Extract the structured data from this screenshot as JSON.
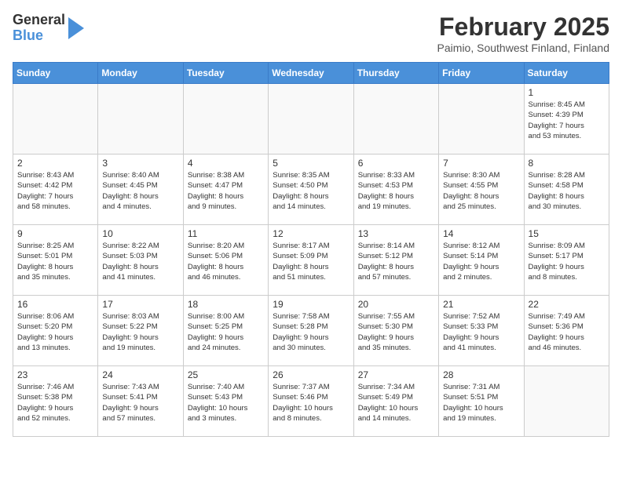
{
  "header": {
    "logo_line1": "General",
    "logo_line2": "Blue",
    "title": "February 2025",
    "location": "Paimio, Southwest Finland, Finland"
  },
  "calendar": {
    "weekdays": [
      "Sunday",
      "Monday",
      "Tuesday",
      "Wednesday",
      "Thursday",
      "Friday",
      "Saturday"
    ],
    "rows": [
      [
        {
          "day": "",
          "info": ""
        },
        {
          "day": "",
          "info": ""
        },
        {
          "day": "",
          "info": ""
        },
        {
          "day": "",
          "info": ""
        },
        {
          "day": "",
          "info": ""
        },
        {
          "day": "",
          "info": ""
        },
        {
          "day": "1",
          "info": "Sunrise: 8:45 AM\nSunset: 4:39 PM\nDaylight: 7 hours\nand 53 minutes."
        }
      ],
      [
        {
          "day": "2",
          "info": "Sunrise: 8:43 AM\nSunset: 4:42 PM\nDaylight: 7 hours\nand 58 minutes."
        },
        {
          "day": "3",
          "info": "Sunrise: 8:40 AM\nSunset: 4:45 PM\nDaylight: 8 hours\nand 4 minutes."
        },
        {
          "day": "4",
          "info": "Sunrise: 8:38 AM\nSunset: 4:47 PM\nDaylight: 8 hours\nand 9 minutes."
        },
        {
          "day": "5",
          "info": "Sunrise: 8:35 AM\nSunset: 4:50 PM\nDaylight: 8 hours\nand 14 minutes."
        },
        {
          "day": "6",
          "info": "Sunrise: 8:33 AM\nSunset: 4:53 PM\nDaylight: 8 hours\nand 19 minutes."
        },
        {
          "day": "7",
          "info": "Sunrise: 8:30 AM\nSunset: 4:55 PM\nDaylight: 8 hours\nand 25 minutes."
        },
        {
          "day": "8",
          "info": "Sunrise: 8:28 AM\nSunset: 4:58 PM\nDaylight: 8 hours\nand 30 minutes."
        }
      ],
      [
        {
          "day": "9",
          "info": "Sunrise: 8:25 AM\nSunset: 5:01 PM\nDaylight: 8 hours\nand 35 minutes."
        },
        {
          "day": "10",
          "info": "Sunrise: 8:22 AM\nSunset: 5:03 PM\nDaylight: 8 hours\nand 41 minutes."
        },
        {
          "day": "11",
          "info": "Sunrise: 8:20 AM\nSunset: 5:06 PM\nDaylight: 8 hours\nand 46 minutes."
        },
        {
          "day": "12",
          "info": "Sunrise: 8:17 AM\nSunset: 5:09 PM\nDaylight: 8 hours\nand 51 minutes."
        },
        {
          "day": "13",
          "info": "Sunrise: 8:14 AM\nSunset: 5:12 PM\nDaylight: 8 hours\nand 57 minutes."
        },
        {
          "day": "14",
          "info": "Sunrise: 8:12 AM\nSunset: 5:14 PM\nDaylight: 9 hours\nand 2 minutes."
        },
        {
          "day": "15",
          "info": "Sunrise: 8:09 AM\nSunset: 5:17 PM\nDaylight: 9 hours\nand 8 minutes."
        }
      ],
      [
        {
          "day": "16",
          "info": "Sunrise: 8:06 AM\nSunset: 5:20 PM\nDaylight: 9 hours\nand 13 minutes."
        },
        {
          "day": "17",
          "info": "Sunrise: 8:03 AM\nSunset: 5:22 PM\nDaylight: 9 hours\nand 19 minutes."
        },
        {
          "day": "18",
          "info": "Sunrise: 8:00 AM\nSunset: 5:25 PM\nDaylight: 9 hours\nand 24 minutes."
        },
        {
          "day": "19",
          "info": "Sunrise: 7:58 AM\nSunset: 5:28 PM\nDaylight: 9 hours\nand 30 minutes."
        },
        {
          "day": "20",
          "info": "Sunrise: 7:55 AM\nSunset: 5:30 PM\nDaylight: 9 hours\nand 35 minutes."
        },
        {
          "day": "21",
          "info": "Sunrise: 7:52 AM\nSunset: 5:33 PM\nDaylight: 9 hours\nand 41 minutes."
        },
        {
          "day": "22",
          "info": "Sunrise: 7:49 AM\nSunset: 5:36 PM\nDaylight: 9 hours\nand 46 minutes."
        }
      ],
      [
        {
          "day": "23",
          "info": "Sunrise: 7:46 AM\nSunset: 5:38 PM\nDaylight: 9 hours\nand 52 minutes."
        },
        {
          "day": "24",
          "info": "Sunrise: 7:43 AM\nSunset: 5:41 PM\nDaylight: 9 hours\nand 57 minutes."
        },
        {
          "day": "25",
          "info": "Sunrise: 7:40 AM\nSunset: 5:43 PM\nDaylight: 10 hours\nand 3 minutes."
        },
        {
          "day": "26",
          "info": "Sunrise: 7:37 AM\nSunset: 5:46 PM\nDaylight: 10 hours\nand 8 minutes."
        },
        {
          "day": "27",
          "info": "Sunrise: 7:34 AM\nSunset: 5:49 PM\nDaylight: 10 hours\nand 14 minutes."
        },
        {
          "day": "28",
          "info": "Sunrise: 7:31 AM\nSunset: 5:51 PM\nDaylight: 10 hours\nand 19 minutes."
        },
        {
          "day": "",
          "info": ""
        }
      ]
    ]
  }
}
